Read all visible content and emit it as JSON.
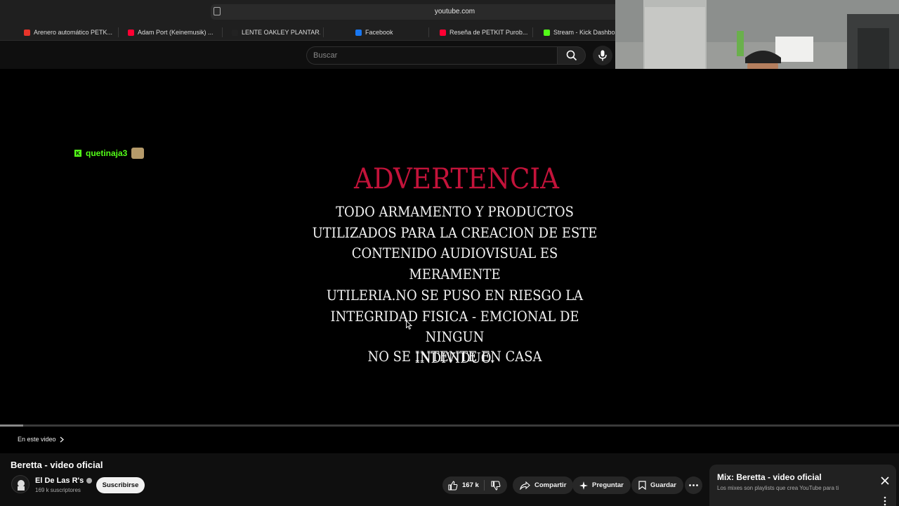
{
  "browser": {
    "url": "youtube.com",
    "bookmarks": [
      {
        "label": "Arenero automático PETK...",
        "color": "#e7342a"
      },
      {
        "label": "Adam Port (Keinemusik) ...",
        "color": "#ff0033"
      },
      {
        "label": "LENTE OAKLEY PLANTAR...",
        "color": "#222222"
      },
      {
        "label": "Facebook",
        "color": "#1877f2"
      },
      {
        "label": "Reseña de PETKIT Purob...",
        "color": "#ff0033"
      },
      {
        "label": "Stream - Kick Dashboard",
        "color": "#53fc18"
      }
    ]
  },
  "youtube": {
    "search_placeholder": "Buscar"
  },
  "overlay": {
    "chat_user": "quetinaja3"
  },
  "video": {
    "warning_title": "ADVERTENCIA",
    "warning_lines": [
      "TODO ARMAMENTO Y PRODUCTOS",
      "UTILIZADOS PARA LA CREACION DE ESTE",
      "CONTENIDO AUDIOVISUAL ES MERAMENTE",
      "UTILERIA.NO SE PUSO EN RIESGO LA",
      "INTEGRIDAD FISICA - EMCIONAL DE NINGUN",
      "INDIVIDUO."
    ],
    "warning_footer": "NO SE INTENTE EN CASA",
    "progress_fraction": 0.026,
    "chapters_label": "En este video"
  },
  "details": {
    "title": "Beretta - video oficial",
    "channel_name": "El De Las R's",
    "subscribers": "169 k suscriptores",
    "subscribe_label": "Suscribirse",
    "likes": "167 k",
    "share_label": "Compartir",
    "ask_label": "Preguntar",
    "save_label": "Guardar"
  },
  "mix_panel": {
    "title": "Mix: Beretta - video oficial",
    "subtitle": "Los mixes son playlists que crea YouTube para ti"
  },
  "colors": {
    "accent_red": "#c3133a",
    "kick_green": "#53fc18"
  }
}
